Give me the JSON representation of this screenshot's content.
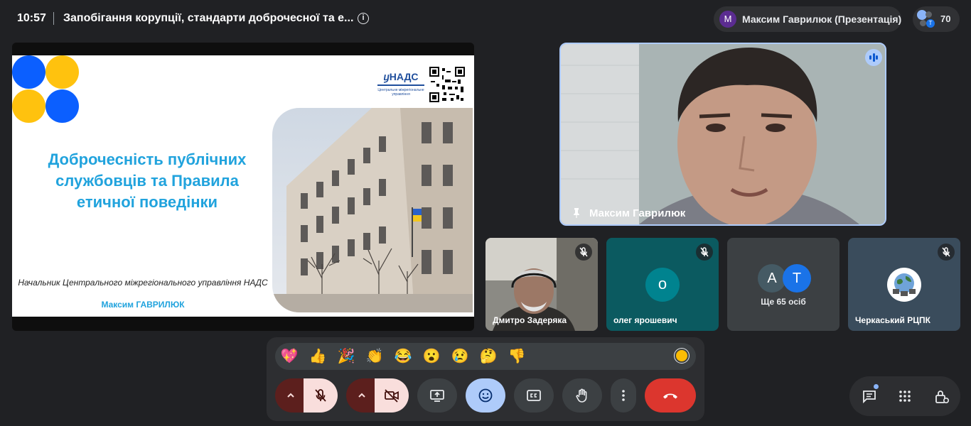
{
  "header": {
    "time": "10:57",
    "meeting_title": "Запобігання корупції, стандарти доброчесної та е...",
    "info_icon": "info-icon",
    "presenter_initial": "M",
    "presenter_label": "Максим Гаврилюк (Презентація)",
    "participant_count": "70",
    "participant_mini_initial": "T"
  },
  "slide": {
    "logo_text": "ⴘНАДС",
    "logo_subtitle": "Центральне міжрегіональне управління",
    "title": "Доброчесність публічних службовців та Правила етичної поведінки",
    "caption_position": "Начальник Центрального міжрегіонального управління НАДС",
    "caption_name": "Максим ГАВРИЛЮК"
  },
  "main_tile": {
    "name": "Максим Гаврилюк",
    "icons": [
      "pin-icon",
      "speaking-icon"
    ]
  },
  "tiles": [
    {
      "name": "Дмитро Задеряка",
      "muted": true
    },
    {
      "name": "олег ярошевич",
      "avatar": "о",
      "avatar_color": "#00838f",
      "muted": true
    },
    {
      "label": "Ще 65 осіб",
      "avatars": [
        "A",
        "T"
      ],
      "avatar_colors": [
        "#455a64",
        "#1a73e8"
      ]
    },
    {
      "name": "Черкаський РЦПК",
      "muted": true
    }
  ],
  "reactions": [
    "💖",
    "👍",
    "🎉",
    "👏",
    "😂",
    "😮",
    "😢",
    "🤔",
    "👎"
  ],
  "controls": [
    {
      "name": "mic-options",
      "icon": "chevron-up-icon"
    },
    {
      "name": "microphone",
      "icon": "mic-off-icon",
      "state": "off"
    },
    {
      "name": "camera-options",
      "icon": "chevron-up-icon"
    },
    {
      "name": "camera",
      "icon": "camera-off-icon",
      "state": "off"
    },
    {
      "name": "present",
      "icon": "present-screen-icon"
    },
    {
      "name": "reactions",
      "icon": "emoji-icon",
      "state": "active"
    },
    {
      "name": "captions",
      "icon": "captions-icon"
    },
    {
      "name": "raise-hand",
      "icon": "hand-icon"
    },
    {
      "name": "more-options",
      "icon": "more-vert-icon"
    },
    {
      "name": "leave-call",
      "icon": "phone-hangup-icon"
    }
  ],
  "side_controls": [
    "chat-icon",
    "activities-icon",
    "host-controls-icon"
  ],
  "colors": {
    "background": "#202124",
    "accent_blue": "#aecbfa",
    "danger_red": "#ea4335",
    "slide_title": "#21a3dd"
  }
}
